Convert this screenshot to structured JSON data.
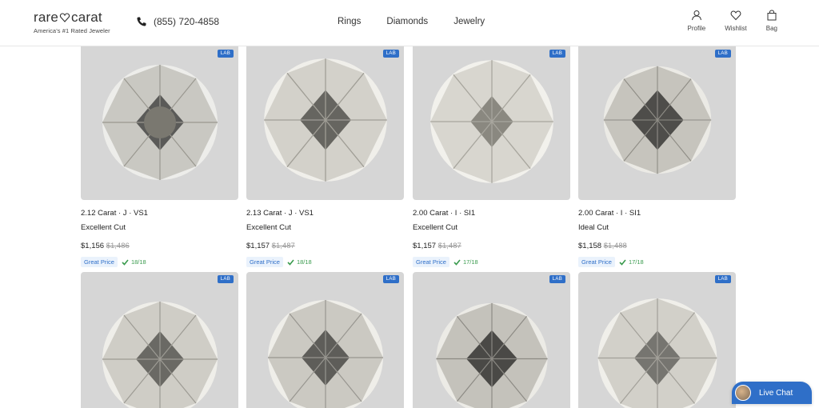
{
  "header": {
    "logo_text_left": "rare",
    "logo_text_right": "carat",
    "logo_tagline": "America's #1 Rated Jeweler",
    "phone": "(855) 720-4858",
    "nav": [
      "Rings",
      "Diamonds",
      "Jewelry"
    ],
    "actions": {
      "profile": "Profile",
      "wishlist": "Wishlist",
      "bag": "Bag"
    }
  },
  "badge_label": "LAB",
  "cards": [
    {
      "title": "2.12 Carat · J · VS1",
      "cut": "Excellent Cut",
      "price": "$1,156",
      "old_price": "$1,486",
      "badge": "Great Price",
      "score": "18/18"
    },
    {
      "title": "2.13 Carat · J · VS1",
      "cut": "Excellent Cut",
      "price": "$1,157",
      "old_price": "$1,487",
      "badge": "Great Price",
      "score": "18/18"
    },
    {
      "title": "2.00 Carat · I · SI1",
      "cut": "Excellent Cut",
      "price": "$1,157",
      "old_price": "$1,487",
      "badge": "Great Price",
      "score": "17/18"
    },
    {
      "title": "2.00 Carat · I · SI1",
      "cut": "Ideal Cut",
      "price": "$1,158",
      "old_price": "$1,488",
      "badge": "Great Price",
      "score": "17/18"
    }
  ],
  "chat": {
    "label": "Live Chat"
  },
  "colors": {
    "accent": "#2f6fc8",
    "green": "#3a9b4e",
    "card_bg": "#d6d6d6"
  }
}
